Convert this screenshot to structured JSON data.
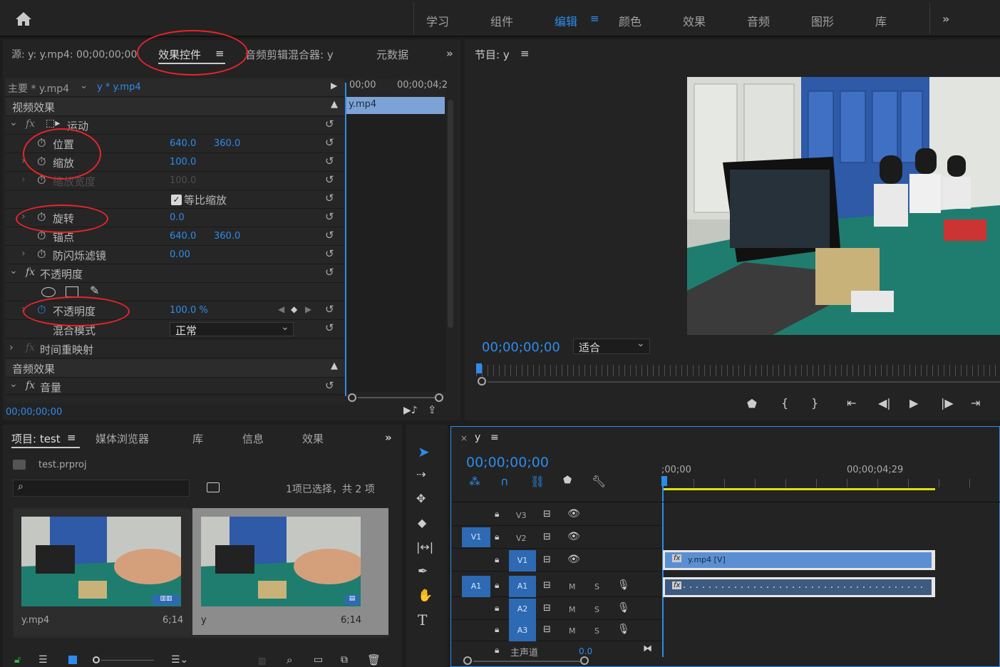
{
  "workspaces": {
    "items": [
      "学习",
      "组件",
      "编辑",
      "颜色",
      "效果",
      "音频",
      "图形",
      "库"
    ],
    "active": "编辑",
    "more": "»"
  },
  "source_panel": {
    "tab_source": "源: y: y.mp4: 00;00;00;00",
    "tab_effect_controls": "效果控件",
    "tab_audio_mixer": "音频剪辑混合器: y",
    "tab_metadata": "元数据",
    "more": "»",
    "master_label": "主要 * y.mp4",
    "sequence_clip": "y * y.mp4",
    "ruler_start": "00;00",
    "ruler_end": "00;00;04;2",
    "clip_name": "y.mp4",
    "video_effects": "视频效果",
    "motion": "运动",
    "position": "位置",
    "position_x": "640.0",
    "position_y": "360.0",
    "scale": "缩放",
    "scale_val": "100.0",
    "scale_width": "缩放宽度",
    "scale_width_val": "100.0",
    "uniform_scale": "等比缩放",
    "rotation": "旋转",
    "rotation_val": "0.0",
    "anchor": "锚点",
    "anchor_x": "640.0",
    "anchor_y": "360.0",
    "flicker": "防闪烁滤镜",
    "flicker_val": "0.00",
    "opacity_group": "不透明度",
    "opacity": "不透明度",
    "opacity_val": "100.0 %",
    "blend_mode": "混合模式",
    "blend_val": "正常",
    "time_remap": "时间重映射",
    "audio_effects": "音频效果",
    "volume": "音量",
    "timecode": "00;00;00;00"
  },
  "program_panel": {
    "title": "节目: y",
    "timecode": "00;00;00;00",
    "fit": "适合"
  },
  "project_panel": {
    "tab_project": "项目: test",
    "tab_media": "媒体浏览器",
    "tab_library": "库",
    "tab_info": "信息",
    "tab_effects": "效果",
    "more": "»",
    "project_file": "test.prproj",
    "selection_info": "1项已选择，共 2 项",
    "items": [
      {
        "name": "y.mp4",
        "duration": "6;14"
      },
      {
        "name": "y",
        "duration": "6;14"
      }
    ]
  },
  "timeline": {
    "tab": "y",
    "timecode": "00;00;00;00",
    "ruler_start": ";00;00",
    "ruler_end": "00;00;04;29",
    "video_tracks": [
      "V3",
      "V2",
      "V1"
    ],
    "audio_tracks": [
      "A1",
      "A2",
      "A3"
    ],
    "source_v": "V1",
    "source_a": "A1",
    "clip_video": "y.mp4 [V]",
    "master": "主声道",
    "master_val": "0.0",
    "mute": "M",
    "solo": "S"
  },
  "colors": {
    "accent": "#2d8ceb",
    "clip": "#5b8fd3",
    "annotation": "#e8242a",
    "work_area": "#e0e010"
  }
}
